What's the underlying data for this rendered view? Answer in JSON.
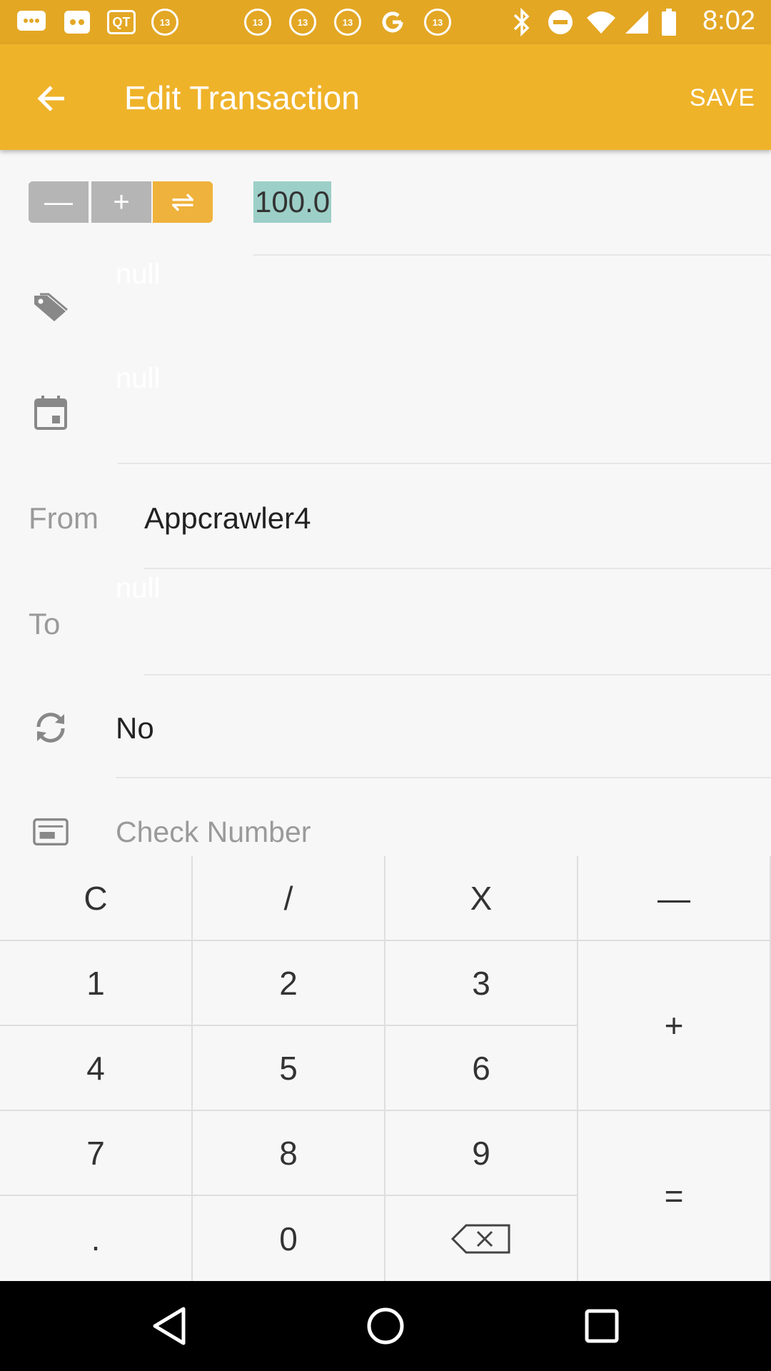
{
  "status_bar": {
    "time": "8:02",
    "left_icons": [
      "messages-icon",
      "cat-face-icon",
      "qt-icon",
      "abc13-icon",
      "abc13-icon",
      "abc13-icon",
      "abc13-icon",
      "google-icon",
      "abc13-icon",
      "bluetooth-icon",
      "do-not-disturb-icon",
      "wifi-icon",
      "signal-icon",
      "battery-icon"
    ],
    "qt_label": "QT",
    "abc_label": "13"
  },
  "app_bar": {
    "title": "Edit Transaction",
    "save_label": "SAVE",
    "color": "#efb32a"
  },
  "type_selector": {
    "minus": "—",
    "plus": "+",
    "transfer": "⇌",
    "selected": "transfer"
  },
  "amount": {
    "value": "100.0"
  },
  "category": {
    "hint": "null"
  },
  "date": {
    "hint": "null"
  },
  "from": {
    "label": "From",
    "value": "Appcrawler4"
  },
  "to": {
    "label": "To",
    "hint": "null"
  },
  "recurring": {
    "value": "No"
  },
  "check_number": {
    "placeholder": "Check Number"
  },
  "keypad": {
    "clear": "C",
    "divide": "/",
    "multiply": "X",
    "minus": "—",
    "plus": "+",
    "equals": "=",
    "dot": ".",
    "digits": [
      "0",
      "1",
      "2",
      "3",
      "4",
      "5",
      "6",
      "7",
      "8",
      "9"
    ]
  },
  "colors": {
    "accent": "#efb32a",
    "status": "#e3a724",
    "amount_highlight": "#9ccfc7"
  }
}
